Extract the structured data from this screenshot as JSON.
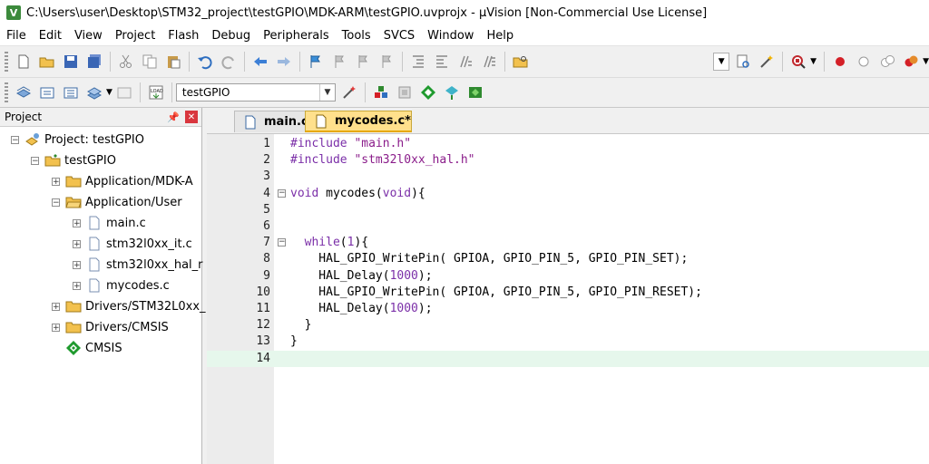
{
  "window": {
    "title": "C:\\Users\\user\\Desktop\\STM32_project\\testGPIO\\MDK-ARM\\testGPIO.uvprojx - µVision  [Non-Commercial Use License]"
  },
  "menu": [
    "File",
    "Edit",
    "View",
    "Project",
    "Flash",
    "Debug",
    "Peripherals",
    "Tools",
    "SVCS",
    "Window",
    "Help"
  ],
  "toolbar2": {
    "target": "testGPIO"
  },
  "project_panel": {
    "title": "Project",
    "tree": [
      {
        "label": "Project: testGPIO"
      },
      {
        "label": "testGPIO"
      },
      {
        "label": "Application/MDK-A"
      },
      {
        "label": "Application/User"
      },
      {
        "label": "main.c"
      },
      {
        "label": "stm32l0xx_it.c"
      },
      {
        "label": "stm32l0xx_hal_r"
      },
      {
        "label": "mycodes.c"
      },
      {
        "label": "Drivers/STM32L0xx_"
      },
      {
        "label": "Drivers/CMSIS"
      },
      {
        "label": "CMSIS"
      }
    ]
  },
  "tabs": [
    {
      "label": "main.c"
    },
    {
      "label": "mycodes.c*"
    }
  ],
  "editor": {
    "lines": [
      {
        "num": "1",
        "text": "#include \"main.h\""
      },
      {
        "num": "2",
        "text": "#include \"stm32l0xx_hal.h\""
      },
      {
        "num": "3",
        "text": ""
      },
      {
        "num": "4",
        "text": "void mycodes(void){"
      },
      {
        "num": "5",
        "text": ""
      },
      {
        "num": "6",
        "text": ""
      },
      {
        "num": "7",
        "text": "  while(1){"
      },
      {
        "num": "8",
        "text": "    HAL_GPIO_WritePin( GPIOA, GPIO_PIN_5, GPIO_PIN_SET);"
      },
      {
        "num": "9",
        "text": "    HAL_Delay(1000);"
      },
      {
        "num": "10",
        "text": "    HAL_GPIO_WritePin( GPIOA, GPIO_PIN_5, GPIO_PIN_RESET);"
      },
      {
        "num": "11",
        "text": "    HAL_Delay(1000);"
      },
      {
        "num": "12",
        "text": "  }"
      },
      {
        "num": "13",
        "text": "}"
      },
      {
        "num": "14",
        "text": ""
      }
    ]
  }
}
